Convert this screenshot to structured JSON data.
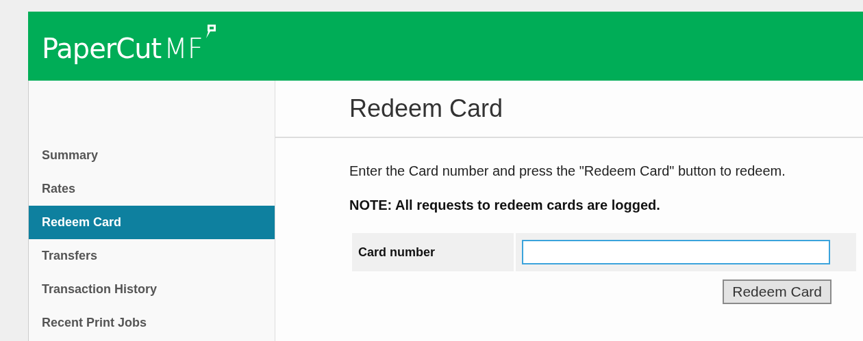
{
  "header": {
    "logo": {
      "name": "PaperCut",
      "suffix": "MF"
    }
  },
  "sidebar": {
    "items": [
      {
        "label": "Summary",
        "selected": false
      },
      {
        "label": "Rates",
        "selected": false
      },
      {
        "label": "Redeem Card",
        "selected": true
      },
      {
        "label": "Transfers",
        "selected": false
      },
      {
        "label": "Transaction History",
        "selected": false
      },
      {
        "label": "Recent Print Jobs",
        "selected": false
      }
    ]
  },
  "content": {
    "title": "Redeem Card",
    "instructions": "Enter the Card number and press the \"Redeem Card\" button to redeem.",
    "note": "NOTE: All requests to redeem cards are logged.",
    "form": {
      "fields": [
        {
          "label": "Card number"
        }
      ],
      "submit": "Redeem Card"
    }
  }
}
